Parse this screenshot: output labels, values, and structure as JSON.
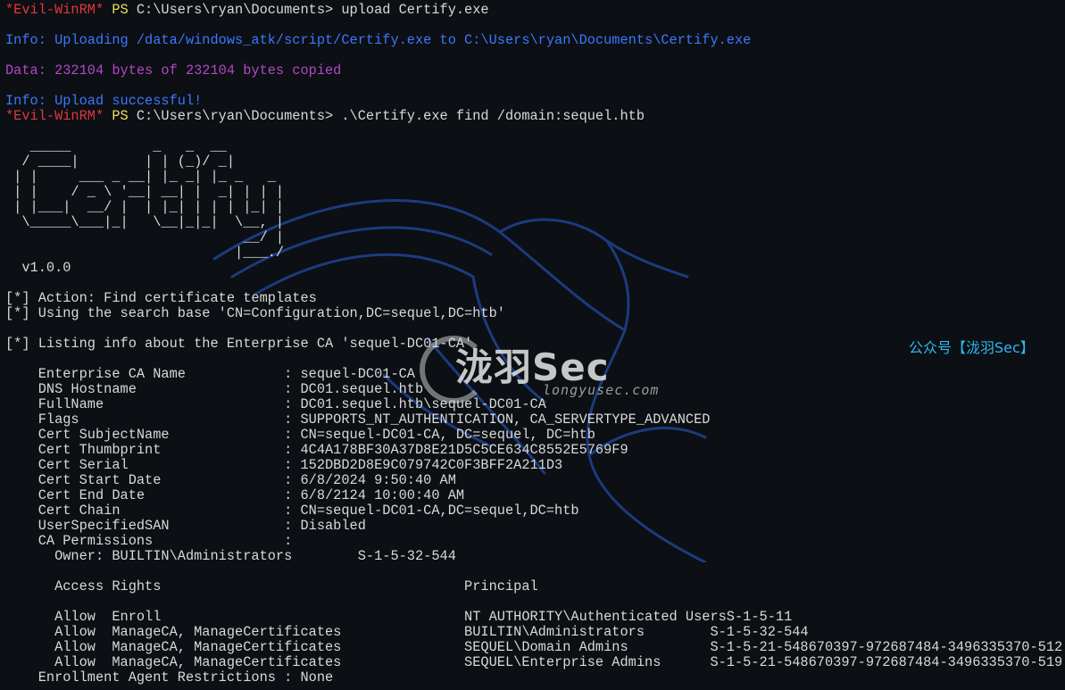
{
  "terminal": {
    "lines": [
      {
        "segments": [
          {
            "text": "*Evil-WinRM*",
            "color": "red"
          },
          {
            "text": " PS ",
            "color": "yellow"
          },
          {
            "text": "C:\\Users\\ryan\\Documents> upload Certify.exe",
            "color": "white"
          }
        ]
      },
      {
        "segments": [
          {
            "text": "",
            "color": "white"
          }
        ]
      },
      {
        "segments": [
          {
            "text": "Info: Uploading /data/windows_atk/script/Certify.exe to C:\\Users\\ryan\\Documents\\Certify.exe",
            "color": "blue"
          }
        ]
      },
      {
        "segments": [
          {
            "text": "",
            "color": "white"
          }
        ]
      },
      {
        "segments": [
          {
            "text": "Data: 232104 bytes of 232104 bytes copied",
            "color": "purple"
          }
        ]
      },
      {
        "segments": [
          {
            "text": "",
            "color": "white"
          }
        ]
      },
      {
        "segments": [
          {
            "text": "Info: Upload successful!",
            "color": "blue"
          }
        ]
      },
      {
        "segments": [
          {
            "text": "*Evil-WinRM*",
            "color": "red"
          },
          {
            "text": " PS ",
            "color": "yellow"
          },
          {
            "text": "C:\\Users\\ryan\\Documents> .\\Certify.exe find /domain:sequel.htb",
            "color": "white"
          }
        ]
      },
      {
        "segments": [
          {
            "text": "",
            "color": "white"
          }
        ]
      },
      {
        "segments": [
          {
            "text": "   _____          _   _  __",
            "color": "white"
          }
        ]
      },
      {
        "segments": [
          {
            "text": "  / ____|        | | (_)/ _|",
            "color": "white"
          }
        ]
      },
      {
        "segments": [
          {
            "text": " | |     ___ _ __| |_ _| |_ _   _",
            "color": "white"
          }
        ]
      },
      {
        "segments": [
          {
            "text": " | |    / _ \\ '__| __| |  _| | | |",
            "color": "white"
          }
        ]
      },
      {
        "segments": [
          {
            "text": " | |___|  __/ |  | |_| | | | |_| |",
            "color": "white"
          }
        ]
      },
      {
        "segments": [
          {
            "text": "  \\_____\\___|_|   \\__|_|_|  \\__, |",
            "color": "white"
          }
        ]
      },
      {
        "segments": [
          {
            "text": "                             __/ |",
            "color": "white"
          }
        ]
      },
      {
        "segments": [
          {
            "text": "                            |___./",
            "color": "white"
          }
        ]
      },
      {
        "segments": [
          {
            "text": "  v1.0.0",
            "color": "white"
          }
        ]
      },
      {
        "segments": [
          {
            "text": "",
            "color": "white"
          }
        ]
      },
      {
        "segments": [
          {
            "text": "[*] Action: Find certificate templates",
            "color": "white"
          }
        ]
      },
      {
        "segments": [
          {
            "text": "[*] Using the search base 'CN=Configuration,DC=sequel,DC=htb'",
            "color": "white"
          }
        ]
      },
      {
        "segments": [
          {
            "text": "",
            "color": "white"
          }
        ]
      },
      {
        "segments": [
          {
            "text": "[*] Listing info about the Enterprise CA 'sequel-DC01-CA'",
            "color": "white"
          }
        ]
      },
      {
        "segments": [
          {
            "text": "",
            "color": "white"
          }
        ]
      },
      {
        "segments": [
          {
            "text": "    Enterprise CA Name            : sequel-DC01-CA",
            "color": "white"
          }
        ]
      },
      {
        "segments": [
          {
            "text": "    DNS Hostname                  : DC01.sequel.htb",
            "color": "white"
          }
        ]
      },
      {
        "segments": [
          {
            "text": "    FullName                      : DC01.sequel.htb\\sequel-DC01-CA",
            "color": "white"
          }
        ]
      },
      {
        "segments": [
          {
            "text": "    Flags                         : SUPPORTS_NT_AUTHENTICATION, CA_SERVERTYPE_ADVANCED",
            "color": "white"
          }
        ]
      },
      {
        "segments": [
          {
            "text": "    Cert SubjectName              : CN=sequel-DC01-CA, DC=sequel, DC=htb",
            "color": "white"
          }
        ]
      },
      {
        "segments": [
          {
            "text": "    Cert Thumbprint               : 4C4A178BF30A37D8E21D5C5CE634C8552E5769F9",
            "color": "white"
          }
        ]
      },
      {
        "segments": [
          {
            "text": "    Cert Serial                   : 152DBD2D8E9C079742C0F3BFF2A211D3",
            "color": "white"
          }
        ]
      },
      {
        "segments": [
          {
            "text": "    Cert Start Date               : 6/8/2024 9:50:40 AM",
            "color": "white"
          }
        ]
      },
      {
        "segments": [
          {
            "text": "    Cert End Date                 : 6/8/2124 10:00:40 AM",
            "color": "white"
          }
        ]
      },
      {
        "segments": [
          {
            "text": "    Cert Chain                    : CN=sequel-DC01-CA,DC=sequel,DC=htb",
            "color": "white"
          }
        ]
      },
      {
        "segments": [
          {
            "text": "    UserSpecifiedSAN              : Disabled",
            "color": "white"
          }
        ]
      },
      {
        "segments": [
          {
            "text": "    CA Permissions                :",
            "color": "white"
          }
        ]
      },
      {
        "segments": [
          {
            "text": "      Owner: BUILTIN\\Administrators        S-1-5-32-544",
            "color": "white"
          }
        ]
      },
      {
        "segments": [
          {
            "text": "",
            "color": "white"
          }
        ]
      },
      {
        "segments": [
          {
            "text": "      Access Rights                                     Principal",
            "color": "white"
          }
        ]
      },
      {
        "segments": [
          {
            "text": "",
            "color": "white"
          }
        ]
      },
      {
        "segments": [
          {
            "text": "      Allow  Enroll                                     NT AUTHORITY\\Authenticated UsersS-1-5-11",
            "color": "white"
          }
        ]
      },
      {
        "segments": [
          {
            "text": "      Allow  ManageCA, ManageCertificates               BUILTIN\\Administrators        S-1-5-32-544",
            "color": "white"
          }
        ]
      },
      {
        "segments": [
          {
            "text": "      Allow  ManageCA, ManageCertificates               SEQUEL\\Domain Admins          S-1-5-21-548670397-972687484-3496335370-512",
            "color": "white"
          }
        ]
      },
      {
        "segments": [
          {
            "text": "      Allow  ManageCA, ManageCertificates               SEQUEL\\Enterprise Admins      S-1-5-21-548670397-972687484-3496335370-519",
            "color": "white"
          }
        ]
      },
      {
        "segments": [
          {
            "text": "    Enrollment Agent Restrictions : None",
            "color": "white"
          }
        ]
      }
    ]
  },
  "watermark": {
    "brand": "泷羽Sec",
    "site": "longyusec.com",
    "wechat_tag": "公众号【泷羽Sec】",
    "icon": "dragon-icon"
  },
  "colors": {
    "background": "#0c0f13",
    "red": "#e0383e",
    "yellow": "#f1e05a",
    "blue": "#3b78ff",
    "purple": "#b148c6",
    "text": "#d9d9d9",
    "watermark_accent": "#2fb6f0"
  }
}
